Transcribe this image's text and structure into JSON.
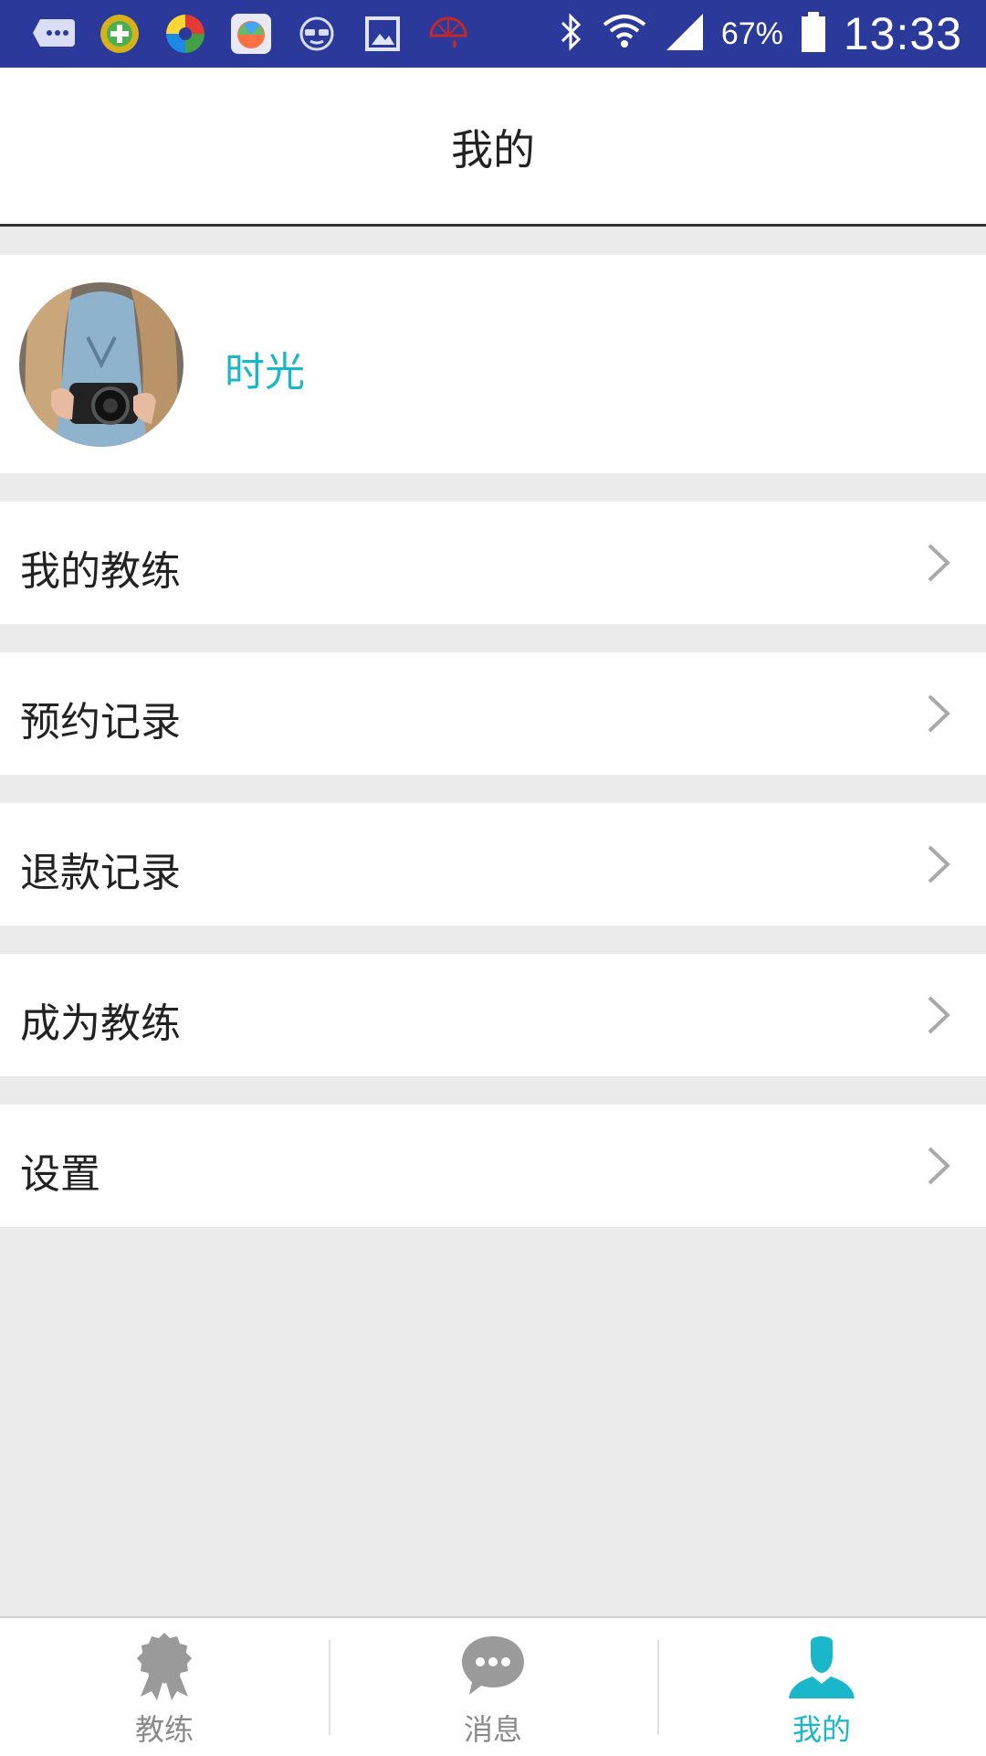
{
  "status_bar": {
    "battery": "67%",
    "time": "13:33",
    "left_icons": [
      "chat-notification-icon",
      "plus-coin-app-icon",
      "color-app-icon",
      "appstore-icon",
      "sunglasses-icon",
      "image-icon",
      "umbrella-app-icon"
    ],
    "right_icons": [
      "bluetooth-icon",
      "wifi-icon",
      "signal-icon",
      "battery-icon"
    ]
  },
  "header": {
    "title": "我的"
  },
  "profile": {
    "name": "时光"
  },
  "menu": {
    "items": [
      {
        "label": "我的教练"
      },
      {
        "label": "预约记录"
      },
      {
        "label": "退款记录"
      },
      {
        "label": "成为教练"
      },
      {
        "label": "设置"
      }
    ]
  },
  "bottom_nav": {
    "tabs": [
      {
        "label": "教练",
        "icon": "medal-icon"
      },
      {
        "label": "消息",
        "icon": "chat-bubble-icon"
      },
      {
        "label": "我的",
        "icon": "person-icon",
        "active": true
      }
    ]
  },
  "colors": {
    "status_bar": "#2b3a9a",
    "accent": "#1ab6c9",
    "background": "#ebebeb",
    "inactive_icon": "#8a8a8a"
  }
}
